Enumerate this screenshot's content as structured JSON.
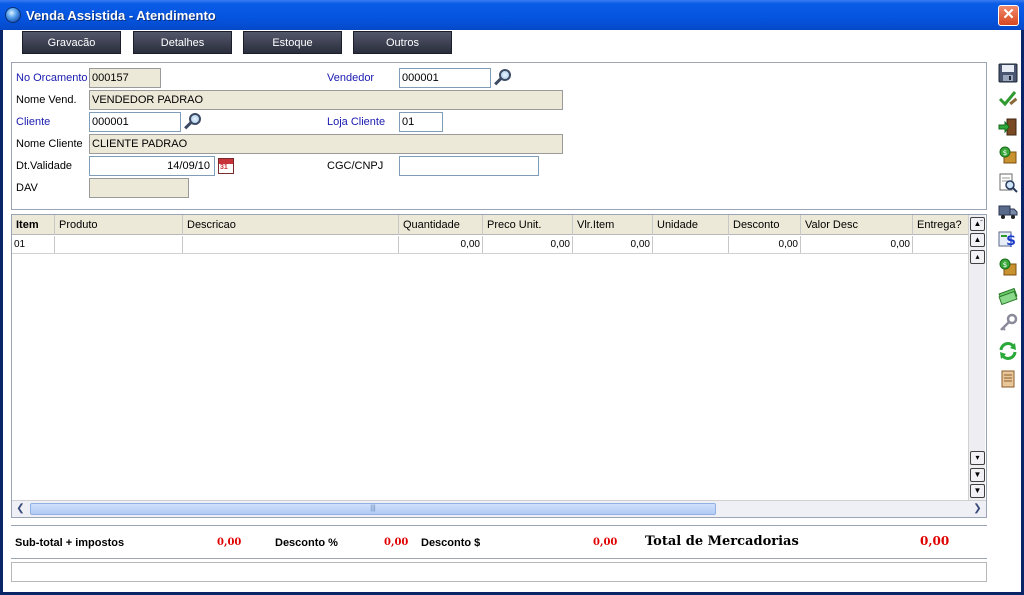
{
  "window": {
    "title": "Venda Assistida - Atendimento",
    "close_symbol": "✕"
  },
  "top_buttons": [
    "Gravacão",
    "Detalhes",
    "Estoque",
    "Outros"
  ],
  "header": {
    "orcamento_label": "No Orcamento",
    "orcamento_value": "000157",
    "vendedor_label": "Vendedor",
    "vendedor_value": "000001",
    "nome_vend_label": "Nome Vend.",
    "nome_vend_value": "VENDEDOR PADRAO",
    "cliente_label": "Cliente",
    "cliente_value": "000001",
    "loja_label": "Loja Cliente",
    "loja_value": "01",
    "nome_cliente_label": "Nome Cliente",
    "nome_cliente_value": "CLIENTE PADRAO",
    "validade_label": "Dt.Validade",
    "validade_value": "14/09/10",
    "cgc_label": "CGC/CNPJ",
    "cgc_value": "",
    "dav_label": "DAV",
    "dav_value": "",
    "calendar_day": "31"
  },
  "grid": {
    "columns": [
      "Item",
      "Produto",
      "Descricao",
      "Quantidade",
      "Preco Unit.",
      "Vlr.Item",
      "Unidade",
      "Desconto",
      "Valor Desc",
      "Entrega?"
    ],
    "rows": [
      {
        "item": "01",
        "produto": "",
        "descricao": "",
        "quantidade": "0,00",
        "preco": "0,00",
        "vlr": "0,00",
        "unidade": "",
        "desconto": "0,00",
        "valor_desc": "0,00",
        "entrega": ""
      }
    ],
    "hscroll_grip": "|||"
  },
  "totals": {
    "subtotal_label": "Sub-total + impostos",
    "subtotal_value": "0,00",
    "desc_pct_label": "Desconto %",
    "desc_pct_value": "0,00",
    "desc_val_label": "Desconto $",
    "desc_val_value": "0,00",
    "total_label": "Total de Mercadorias",
    "total_value": "0,00"
  },
  "toolbar_icons": [
    "save-icon",
    "check-edit-icon",
    "exit-door-icon",
    "money-box-icon",
    "preview-icon",
    "delivery-truck-icon",
    "currency-exchange-icon",
    "money-box-icon",
    "cash-bills-icon",
    "key-icon",
    "refresh-icon",
    "scroll-icon"
  ],
  "colors": {
    "title_bar": "#0554e0",
    "field_label_blue": "#1a1ab0",
    "total_red": "#e00000",
    "button_dark": "#2a2e3c",
    "readonly_bg": "#ece9d8"
  }
}
